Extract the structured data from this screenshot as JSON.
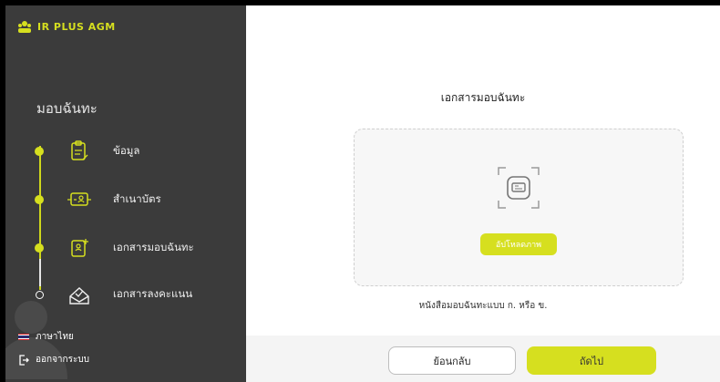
{
  "brand": {
    "name": "IR PLUS AGM"
  },
  "sidebar": {
    "title": "มอบฉันทะ",
    "steps": [
      {
        "label": "ข้อมูล",
        "icon": "clipboard-icon",
        "state": "done"
      },
      {
        "label": "สำเนาบัตร",
        "icon": "id-card-icon",
        "state": "done"
      },
      {
        "label": "เอกสารมอบฉันทะ",
        "icon": "proxy-document-icon",
        "state": "current"
      },
      {
        "label": "เอกสารลงคะแนน",
        "icon": "vote-ballot-icon",
        "state": "pending"
      }
    ],
    "language": "ภาษาไทย",
    "logout": "ออกจากระบบ"
  },
  "main": {
    "title": "เอกสารมอบฉันทะ",
    "upload_button": "อัปโหลดภาพ",
    "hint": "หนังสือมอบฉันทะแบบ ก. หรือ ข.",
    "back_button": "ย้อนกลับ",
    "next_button": "ถัดไป"
  },
  "colors": {
    "accent": "#d6df1f",
    "sidebar_bg": "#3b3b3b"
  }
}
